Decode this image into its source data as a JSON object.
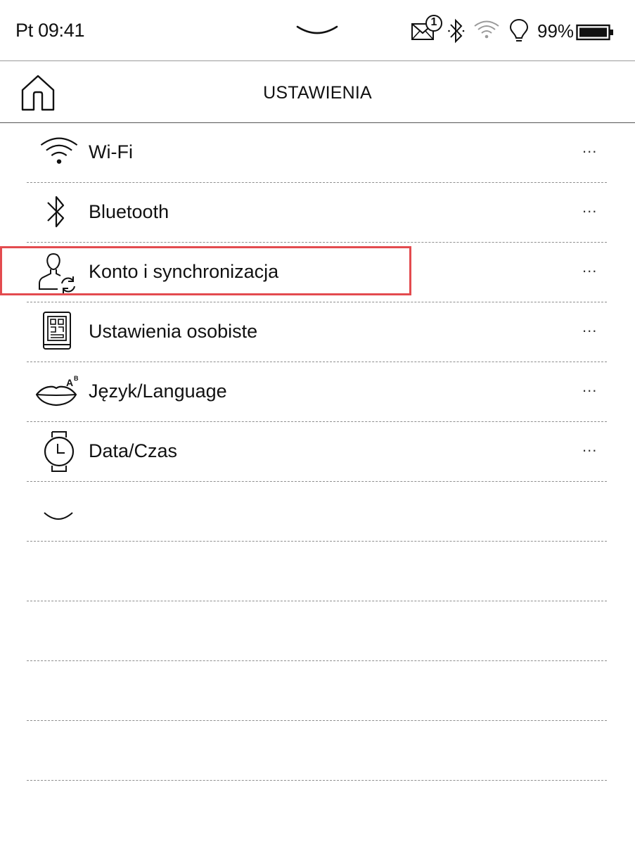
{
  "status_bar": {
    "time": "Pt 09:41",
    "notification_count": "1",
    "battery": "99%",
    "icons": [
      "message-icon",
      "bluetooth-icon",
      "wifi-icon",
      "lightbulb-icon",
      "battery-icon"
    ]
  },
  "header": {
    "title": "USTAWIENIA",
    "home_icon": "home-icon"
  },
  "menu": {
    "items": [
      {
        "label": "Wi-Fi",
        "more": "...",
        "icon": "wifi-icon"
      },
      {
        "label": "Bluetooth",
        "more": "...",
        "icon": "bluetooth-icon"
      },
      {
        "label": "Konto i synchronizacja",
        "more": "...",
        "icon": "account-sync-icon"
      },
      {
        "label": "Ustawienia osobiste",
        "more": "...",
        "icon": "personal-settings-icon"
      },
      {
        "label": "Język/Language",
        "more": "...",
        "icon": "language-icon"
      },
      {
        "label": "Data/Czas",
        "more": "...",
        "icon": "watch-icon"
      }
    ],
    "expand_icon": "chevron-down-icon"
  },
  "colors": {
    "highlight": "#e34b4f",
    "text": "#111111",
    "background": "#ffffff"
  }
}
